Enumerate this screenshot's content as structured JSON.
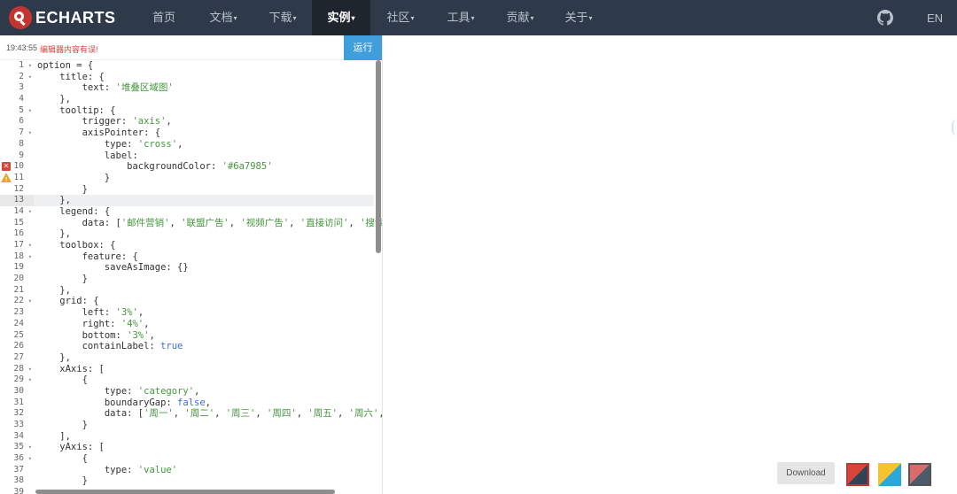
{
  "nav": {
    "logo_text": "ECHARTS",
    "items": [
      {
        "label": "首页",
        "caret": "",
        "active": false
      },
      {
        "label": "文档",
        "caret": "▾",
        "active": false
      },
      {
        "label": "下载",
        "caret": "▾",
        "active": false
      },
      {
        "label": "实例",
        "caret": "▾",
        "active": true
      },
      {
        "label": "社区",
        "caret": "▾",
        "active": false
      },
      {
        "label": "工具",
        "caret": "▾",
        "active": false
      },
      {
        "label": "贡献",
        "caret": "▾",
        "active": false
      },
      {
        "label": "关于",
        "caret": "▾",
        "active": false
      }
    ],
    "lang": "EN"
  },
  "editor": {
    "time": "19:43:55",
    "error_message": "编辑器内容有误!",
    "run_label": "运行",
    "code_lines": [
      [
        [
          "p",
          "option = {"
        ]
      ],
      [
        [
          "p",
          "    title: {"
        ]
      ],
      [
        [
          "p",
          "        text: "
        ],
        [
          "s",
          "'堆叠区域图'"
        ]
      ],
      [
        [
          "p",
          "    },"
        ]
      ],
      [
        [
          "p",
          "    tooltip: {"
        ]
      ],
      [
        [
          "p",
          "        trigger: "
        ],
        [
          "s",
          "'axis'"
        ],
        [
          "p",
          ","
        ]
      ],
      [
        [
          "p",
          "        axisPointer: {"
        ]
      ],
      [
        [
          "p",
          "            type: "
        ],
        [
          "s",
          "'cross'"
        ],
        [
          "p",
          ","
        ]
      ],
      [
        [
          "p",
          "            label:"
        ]
      ],
      [
        [
          "p",
          "                backgroundColor: "
        ],
        [
          "s",
          "'#6a7985'"
        ]
      ],
      [
        [
          "p",
          "            }"
        ]
      ],
      [
        [
          "p",
          "        }"
        ]
      ],
      [
        [
          "p",
          "    },"
        ]
      ],
      [
        [
          "p",
          "    legend: {"
        ]
      ],
      [
        [
          "p",
          "        data: ["
        ],
        [
          "s",
          "'邮件营销'"
        ],
        [
          "p",
          ", "
        ],
        [
          "s",
          "'联盟广告'"
        ],
        [
          "p",
          ", "
        ],
        [
          "s",
          "'视频广告'"
        ],
        [
          "p",
          ", "
        ],
        [
          "s",
          "'直接访问'"
        ],
        [
          "p",
          ", "
        ],
        [
          "s",
          "'搜索"
        ]
      ],
      [
        [
          "p",
          "    },"
        ]
      ],
      [
        [
          "p",
          "    toolbox: {"
        ]
      ],
      [
        [
          "p",
          "        feature: {"
        ]
      ],
      [
        [
          "p",
          "            saveAsImage: {}"
        ]
      ],
      [
        [
          "p",
          "        }"
        ]
      ],
      [
        [
          "p",
          "    },"
        ]
      ],
      [
        [
          "p",
          "    grid: {"
        ]
      ],
      [
        [
          "p",
          "        left: "
        ],
        [
          "s",
          "'3%'"
        ],
        [
          "p",
          ","
        ]
      ],
      [
        [
          "p",
          "        right: "
        ],
        [
          "s",
          "'4%'"
        ],
        [
          "p",
          ","
        ]
      ],
      [
        [
          "p",
          "        bottom: "
        ],
        [
          "s",
          "'3%'"
        ],
        [
          "p",
          ","
        ]
      ],
      [
        [
          "p",
          "        containLabel: "
        ],
        [
          "b",
          "true"
        ]
      ],
      [
        [
          "p",
          "    },"
        ]
      ],
      [
        [
          "p",
          "    xAxis: ["
        ]
      ],
      [
        [
          "p",
          "        {"
        ]
      ],
      [
        [
          "p",
          "            type: "
        ],
        [
          "s",
          "'category'"
        ],
        [
          "p",
          ","
        ]
      ],
      [
        [
          "p",
          "            boundaryGap: "
        ],
        [
          "b",
          "false"
        ],
        [
          "p",
          ","
        ]
      ],
      [
        [
          "p",
          "            data: ["
        ],
        [
          "s",
          "'周一'"
        ],
        [
          "p",
          ", "
        ],
        [
          "s",
          "'周二'"
        ],
        [
          "p",
          ", "
        ],
        [
          "s",
          "'周三'"
        ],
        [
          "p",
          ", "
        ],
        [
          "s",
          "'周四'"
        ],
        [
          "p",
          ", "
        ],
        [
          "s",
          "'周五'"
        ],
        [
          "p",
          ", "
        ],
        [
          "s",
          "'周六'"
        ],
        [
          "p",
          ","
        ]
      ],
      [
        [
          "p",
          "        }"
        ]
      ],
      [
        [
          "p",
          "    ],"
        ]
      ],
      [
        [
          "p",
          "    yAxis: ["
        ]
      ],
      [
        [
          "p",
          "        {"
        ]
      ],
      [
        [
          "p",
          "            type: "
        ],
        [
          "s",
          "'value'"
        ]
      ],
      [
        [
          "p",
          "        }"
        ]
      ],
      [
        [
          "p",
          ""
        ]
      ]
    ],
    "gutter": [
      {
        "n": "1",
        "fold": "▾"
      },
      {
        "n": "2",
        "fold": "▾"
      },
      {
        "n": "3",
        "fold": ""
      },
      {
        "n": "4",
        "fold": ""
      },
      {
        "n": "5",
        "fold": "▾"
      },
      {
        "n": "6",
        "fold": ""
      },
      {
        "n": "7",
        "fold": "▾"
      },
      {
        "n": "8",
        "fold": ""
      },
      {
        "n": "9",
        "fold": ""
      },
      {
        "n": "10",
        "fold": "",
        "mark": "error"
      },
      {
        "n": "11",
        "fold": "",
        "mark": "warning"
      },
      {
        "n": "12",
        "fold": ""
      },
      {
        "n": "13",
        "fold": "",
        "active": true
      },
      {
        "n": "14",
        "fold": "▾"
      },
      {
        "n": "15",
        "fold": ""
      },
      {
        "n": "16",
        "fold": ""
      },
      {
        "n": "17",
        "fold": "▾"
      },
      {
        "n": "18",
        "fold": "▾"
      },
      {
        "n": "19",
        "fold": ""
      },
      {
        "n": "20",
        "fold": ""
      },
      {
        "n": "21",
        "fold": ""
      },
      {
        "n": "22",
        "fold": "▾"
      },
      {
        "n": "23",
        "fold": ""
      },
      {
        "n": "24",
        "fold": ""
      },
      {
        "n": "25",
        "fold": ""
      },
      {
        "n": "26",
        "fold": ""
      },
      {
        "n": "27",
        "fold": ""
      },
      {
        "n": "28",
        "fold": "▾"
      },
      {
        "n": "29",
        "fold": "▾"
      },
      {
        "n": "30",
        "fold": ""
      },
      {
        "n": "31",
        "fold": ""
      },
      {
        "n": "32",
        "fold": ""
      },
      {
        "n": "33",
        "fold": ""
      },
      {
        "n": "34",
        "fold": ""
      },
      {
        "n": "35",
        "fold": "▾"
      },
      {
        "n": "36",
        "fold": "▾"
      },
      {
        "n": "37",
        "fold": ""
      },
      {
        "n": "38",
        "fold": ""
      },
      {
        "n": "39",
        "fold": ""
      }
    ],
    "active_line": 13
  },
  "chart_panel": {
    "download_label": "Download"
  },
  "colors": {
    "nav_bg": "#2e3a4a",
    "run_button": "#409eda",
    "error_text": "#e43c3c",
    "string": "#43963b",
    "keyword": "#3c6bd6"
  }
}
